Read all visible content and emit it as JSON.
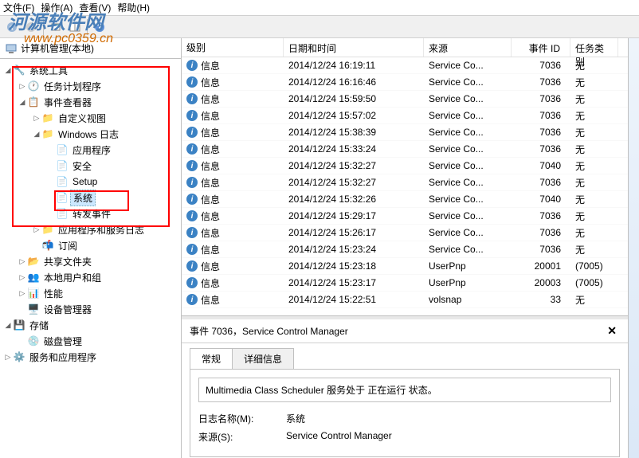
{
  "watermark": {
    "text": "河源软件网",
    "url": "www.pc0359.cn"
  },
  "menu": {
    "file": "文件(F)",
    "action": "操作(A)",
    "view": "查看(V)",
    "help": "帮助(H)"
  },
  "tree_root": "计算机管理(本地)",
  "tree": {
    "sys_tools": "系统工具",
    "task_sched": "任务计划程序",
    "event_viewer": "事件查看器",
    "custom_views": "自定义视图",
    "win_logs": "Windows 日志",
    "app_log": "应用程序",
    "security": "安全",
    "setup": "Setup",
    "system": "系统",
    "forward": "转发事件",
    "app_svc_logs": "应用程序和服务日志",
    "subscriptions": "订阅",
    "shared_folders": "共享文件夹",
    "local_users": "本地用户和组",
    "perf": "性能",
    "device_mgr": "设备管理器",
    "storage": "存储",
    "disk_mgmt": "磁盘管理",
    "svc_apps": "服务和应用程序"
  },
  "columns": {
    "level": "级别",
    "datetime": "日期和时间",
    "source": "来源",
    "eventid": "事件 ID",
    "task": "任务类别"
  },
  "info_label": "信息",
  "events": [
    {
      "dt": "2014/12/24 16:19:11",
      "src": "Service Co...",
      "id": "7036",
      "task": "无"
    },
    {
      "dt": "2014/12/24 16:16:46",
      "src": "Service Co...",
      "id": "7036",
      "task": "无"
    },
    {
      "dt": "2014/12/24 15:59:50",
      "src": "Service Co...",
      "id": "7036",
      "task": "无"
    },
    {
      "dt": "2014/12/24 15:57:02",
      "src": "Service Co...",
      "id": "7036",
      "task": "无"
    },
    {
      "dt": "2014/12/24 15:38:39",
      "src": "Service Co...",
      "id": "7036",
      "task": "无"
    },
    {
      "dt": "2014/12/24 15:33:24",
      "src": "Service Co...",
      "id": "7036",
      "task": "无"
    },
    {
      "dt": "2014/12/24 15:32:27",
      "src": "Service Co...",
      "id": "7040",
      "task": "无"
    },
    {
      "dt": "2014/12/24 15:32:27",
      "src": "Service Co...",
      "id": "7036",
      "task": "无"
    },
    {
      "dt": "2014/12/24 15:32:26",
      "src": "Service Co...",
      "id": "7040",
      "task": "无"
    },
    {
      "dt": "2014/12/24 15:29:17",
      "src": "Service Co...",
      "id": "7036",
      "task": "无"
    },
    {
      "dt": "2014/12/24 15:26:17",
      "src": "Service Co...",
      "id": "7036",
      "task": "无"
    },
    {
      "dt": "2014/12/24 15:23:24",
      "src": "Service Co...",
      "id": "7036",
      "task": "无"
    },
    {
      "dt": "2014/12/24 15:23:18",
      "src": "UserPnp",
      "id": "20001",
      "task": "(7005)"
    },
    {
      "dt": "2014/12/24 15:23:17",
      "src": "UserPnp",
      "id": "20003",
      "task": "(7005)"
    },
    {
      "dt": "2014/12/24 15:22:51",
      "src": "volsnap",
      "id": "33",
      "task": "无"
    }
  ],
  "detail": {
    "title": "事件 7036，Service Control Manager",
    "tab_general": "常规",
    "tab_details": "详细信息",
    "message": "Multimedia Class Scheduler 服务处于 正在运行 状态。",
    "log_name_label": "日志名称(M):",
    "log_name_value": "系统",
    "source_label": "来源(S):",
    "source_value": "Service Control Manager"
  }
}
